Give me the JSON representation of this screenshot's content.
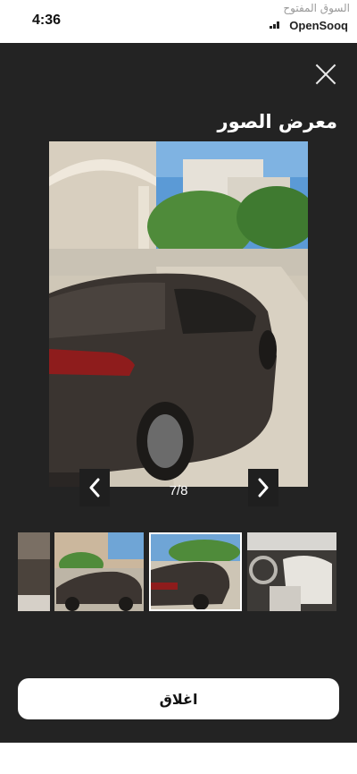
{
  "status_bar": {
    "time": "4:36",
    "watermark_ar": "السوق المفتوح",
    "watermark_en": "OpenSooq"
  },
  "gallery": {
    "title": "معرض الصور",
    "counter": "7/8",
    "close_label": "اغلاق",
    "thumbnails": [
      {
        "subject": "car-interior"
      },
      {
        "subject": "car-side-view"
      },
      {
        "subject": "car-rear-view",
        "selected": true
      },
      {
        "subject": "car-front-seats"
      }
    ]
  },
  "colors": {
    "modal_background": "#232323",
    "button_background": "#ffffff"
  }
}
